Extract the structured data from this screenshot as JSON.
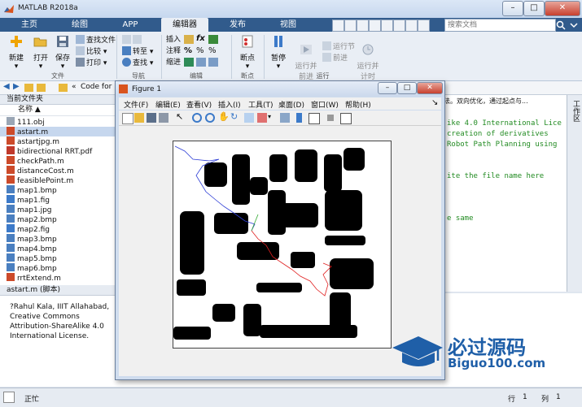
{
  "window": {
    "title": "MATLAB R2018a",
    "minimize": "–",
    "maximize": "□",
    "close": "✕"
  },
  "tabs": [
    {
      "label": "主页"
    },
    {
      "label": "绘图"
    },
    {
      "label": "APP"
    },
    {
      "label": "编辑器"
    },
    {
      "label": "发布"
    },
    {
      "label": "视图"
    }
  ],
  "search_placeholder": "搜索文档",
  "ribbon": {
    "file": {
      "new": "新建",
      "open": "打开",
      "save": "保存",
      "find_file": "查找文件",
      "compare": "比较",
      "print": "打印",
      "group": "文件"
    },
    "navigate": {
      "goto": "转至",
      "find": "查找",
      "group": "导航"
    },
    "edit": {
      "insert": "插入",
      "comment": "注释",
      "indent": "缩进",
      "fx": "fx",
      "group": "编辑"
    },
    "breakpoints": {
      "label": "断点",
      "group": "断点"
    },
    "run": {
      "pause": "暂停",
      "run_advance": "运行并\n前进",
      "run_section": "运行节",
      "advance": "前进",
      "run_time": "运行并\n计时",
      "group": "运行"
    }
  },
  "path": {
    "current_path": "Code for P"
  },
  "files": {
    "header": "当前文件夹",
    "column_name": "名称 ▲",
    "items": [
      {
        "name": "111.obj",
        "type": "obj"
      },
      {
        "name": "astart.m",
        "type": "m",
        "selected": true
      },
      {
        "name": "astartjpg.m",
        "type": "m"
      },
      {
        "name": "bidirectional RRT.pdf",
        "type": "pdf"
      },
      {
        "name": "checkPath.m",
        "type": "m"
      },
      {
        "name": "distanceCost.m",
        "type": "m"
      },
      {
        "name": "feasiblePoint.m",
        "type": "m"
      },
      {
        "name": "map1.bmp",
        "type": "img"
      },
      {
        "name": "map1.fig",
        "type": "fig"
      },
      {
        "name": "map1.jpg",
        "type": "img"
      },
      {
        "name": "map2.bmp",
        "type": "img"
      },
      {
        "name": "map2.fig",
        "type": "fig"
      },
      {
        "name": "map3.bmp",
        "type": "img"
      },
      {
        "name": "map4.bmp",
        "type": "img"
      },
      {
        "name": "map5.bmp",
        "type": "img"
      },
      {
        "name": "map6.bmp",
        "type": "img"
      },
      {
        "name": "rrtExtend.m",
        "type": "m"
      }
    ]
  },
  "details": {
    "header": "astart.m  (脚本)",
    "text": "?Rahul Kala, IIIT Allahabad, Creative Commons Attribution-ShareAlike 4.0 International License."
  },
  "editor": {
    "top_text": "法。双向优化，通过起点与...",
    "lines": [
      "ike 4.0 International Lice",
      " creation of derivatives",
      "Robot Path Planning using",
      "",
      "",
      "ite the file name here",
      "",
      "",
      "",
      "e same"
    ]
  },
  "right_strip_label": "工作区",
  "status": {
    "text": "正忙",
    "row_label": "行",
    "row": "1",
    "col_label": "列",
    "col": "1"
  },
  "figure": {
    "title": "Figure 1",
    "menus": [
      "文件(F)",
      "编辑(E)",
      "查看(V)",
      "插入(I)",
      "工具(T)",
      "桌面(D)",
      "窗口(W)",
      "帮助(H)"
    ]
  },
  "watermark": {
    "main": "必过源码",
    "sub": "Biguo100.com"
  },
  "colors": {
    "tab_bar": "#315b8c",
    "obstacle": "#000000",
    "path_start_tree": "#2f3fd6",
    "path_goal_tree": "#e02020",
    "path_link": "#2ea82e",
    "watermark": "#1f5fa8"
  }
}
